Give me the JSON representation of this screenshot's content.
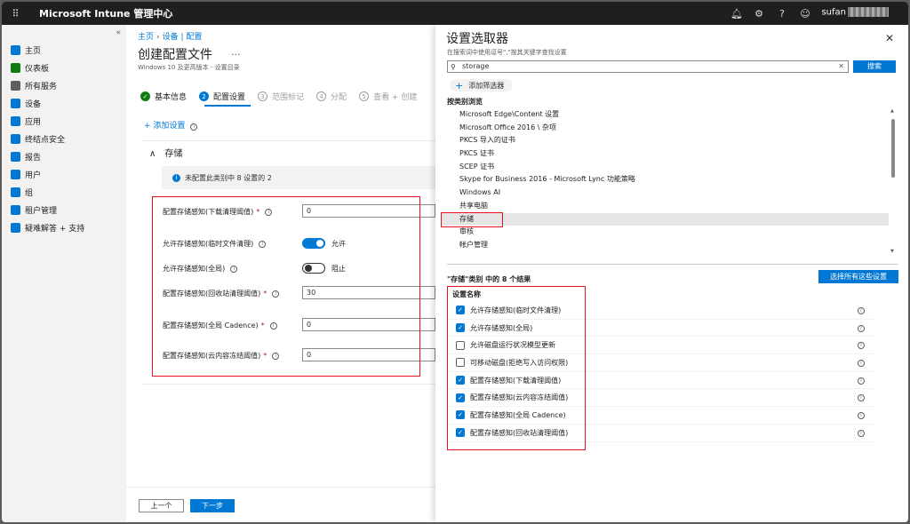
{
  "topbar": {
    "waffle": "⠿",
    "title": "Microsoft Intune 管理中心",
    "user": "sufan"
  },
  "sidebar": {
    "collapse": "«",
    "items": [
      {
        "label": "主页",
        "icon": "home-icon",
        "color": "#0078d4"
      },
      {
        "label": "仪表板",
        "icon": "dashboard-icon",
        "color": "#107c10"
      },
      {
        "label": "所有服务",
        "icon": "all-services-icon",
        "color": "#605e5c"
      },
      {
        "label": "设备",
        "icon": "devices-icon",
        "color": "#0078d4"
      },
      {
        "label": "应用",
        "icon": "apps-icon",
        "color": "#0078d4"
      },
      {
        "label": "终结点安全",
        "icon": "endpoint-security-icon",
        "color": "#0078d4"
      },
      {
        "label": "报告",
        "icon": "reports-icon",
        "color": "#0078d4"
      },
      {
        "label": "用户",
        "icon": "users-icon",
        "color": "#0078d4"
      },
      {
        "label": "组",
        "icon": "groups-icon",
        "color": "#0078d4"
      },
      {
        "label": "租户管理",
        "icon": "tenant-admin-icon",
        "color": "#0078d4"
      },
      {
        "label": "疑难解答 + 支持",
        "icon": "troubleshoot-icon",
        "color": "#0078d4"
      }
    ]
  },
  "main": {
    "breadcrumb": [
      "主页",
      "设备 | 配置"
    ],
    "title": "创建配置文件",
    "more": "...",
    "subtitle": "Windows 10 及更高版本 - 设置目录",
    "steps": [
      {
        "num": "✓",
        "label": "基本信息",
        "state": "done"
      },
      {
        "num": "2",
        "label": "配置设置",
        "state": "active"
      },
      {
        "num": "3",
        "label": "范围标记",
        "state": "pending"
      },
      {
        "num": "4",
        "label": "分配",
        "state": "pending"
      },
      {
        "num": "5",
        "label": "查看 + 创建",
        "state": "pending"
      }
    ],
    "add_setting": "+ 添加设置",
    "section": "存储",
    "section_chevron": "∧",
    "info_text": "未配置此类别中 8 设置的 2",
    "info_glyph": "i",
    "fields": [
      {
        "label": "配置存储感知(下载清理阈值)",
        "required": "*",
        "type": "input",
        "value": "0"
      },
      {
        "label": "允许存储感知(临时文件清理)",
        "required": "",
        "type": "toggle",
        "state": "on",
        "toggle_label": "允许"
      },
      {
        "label": "允许存储感知(全局)",
        "required": "",
        "type": "toggle",
        "state": "off",
        "toggle_label": "阻止"
      },
      {
        "label": "配置存储感知(回收站清理阈值)",
        "required": "*",
        "type": "input",
        "value": "30"
      },
      {
        "label": "配置存储感知(全局 Cadence)",
        "required": "*",
        "type": "input",
        "value": "0"
      },
      {
        "label": "配置存储感知(云内容冻结阈值)",
        "required": "*",
        "type": "input",
        "value": "0"
      }
    ],
    "prev_button": "上一个",
    "next_button": "下一步"
  },
  "panel": {
    "title": "设置选取器",
    "close": "✕",
    "hint": "在搜索词中使用逗号\",\"按其关键字查找设置",
    "search_value": "storage",
    "search_button": "搜索",
    "add_filter": "添加筛选器",
    "browse_label": "按类别浏览",
    "categories": [
      "Microsoft Edge\\Content 设置",
      "Microsoft Office 2016 \\ 杂项",
      "PKCS 导入的证书",
      "PKCS 证书",
      "SCEP 证书",
      "Skype for Business 2016 - Microsoft Lync 功能策略",
      "Windows AI",
      "共享电脑",
      "存储",
      "审核",
      "帐户管理"
    ],
    "selected_category": "存储",
    "results_label": "\"存储\"类别 中的 8 个结果",
    "select_all": "选择所有这些设置",
    "col_head": "设置名称",
    "results": [
      {
        "label": "允许存储感知(临时文件清理)",
        "checked": true
      },
      {
        "label": "允许存储感知(全局)",
        "checked": true
      },
      {
        "label": "允许磁盘运行状况模型更新",
        "checked": false
      },
      {
        "label": "可移动磁盘(拒绝写入访问权限)",
        "checked": false
      },
      {
        "label": "配置存储感知(下载清理阈值)",
        "checked": true
      },
      {
        "label": "配置存储感知(云内容冻结阈值)",
        "checked": true
      },
      {
        "label": "配置存储感知(全局 Cadence)",
        "checked": true
      },
      {
        "label": "配置存储感知(回收站清理阈值)",
        "checked": true
      }
    ]
  }
}
